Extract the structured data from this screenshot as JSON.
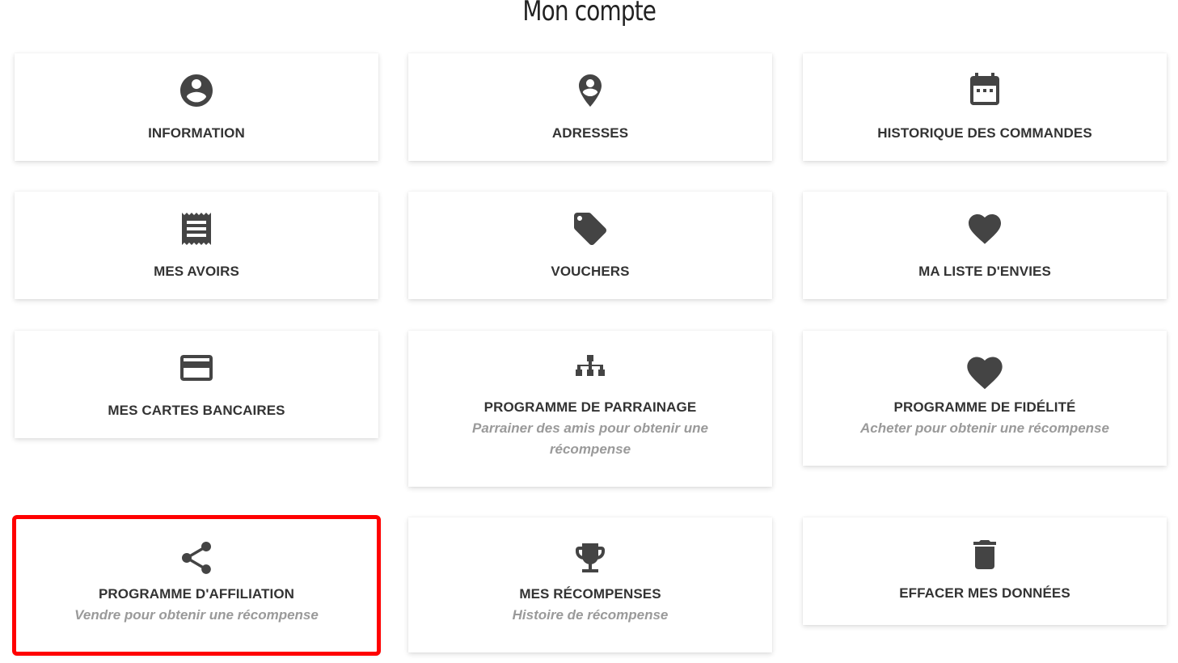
{
  "page": {
    "title": "Mon compte"
  },
  "cards": [
    {
      "icon": "account-circle-icon",
      "label": "INFORMATION"
    },
    {
      "icon": "location-pin-icon",
      "label": "ADRESSES"
    },
    {
      "icon": "calendar-icon",
      "label": "HISTORIQUE DES COMMANDES"
    },
    {
      "icon": "receipt-icon",
      "label": "MES AVOIRS"
    },
    {
      "icon": "tag-icon",
      "label": "VOUCHERS"
    },
    {
      "icon": "heart-icon",
      "label": "MA LISTE D'ENVIES"
    },
    {
      "icon": "credit-card-icon",
      "label": "MES CARTES BANCAIRES"
    },
    {
      "icon": "sitemap-icon",
      "label": "PROGRAMME DE PARRAINAGE",
      "subtitle": "Parrainer des amis pour obtenir une récompense"
    },
    {
      "icon": "heart-icon",
      "label": "PROGRAMME DE FIDÉLITÉ",
      "subtitle": "Acheter pour obtenir une récompense"
    },
    {
      "icon": "share-icon",
      "label": "PROGRAMME D'AFFILIATION",
      "subtitle": "Vendre pour obtenir une récompense"
    },
    {
      "icon": "trophy-icon",
      "label": "MES RÉCOMPENSES",
      "subtitle": "Histoire de récompense"
    },
    {
      "icon": "trash-icon",
      "label": "EFFACER MES DONNÉES"
    }
  ],
  "colors": {
    "icon": "#444444",
    "label": "#333333",
    "subtitle": "#9a9a9a",
    "highlight": "#ff0000"
  }
}
